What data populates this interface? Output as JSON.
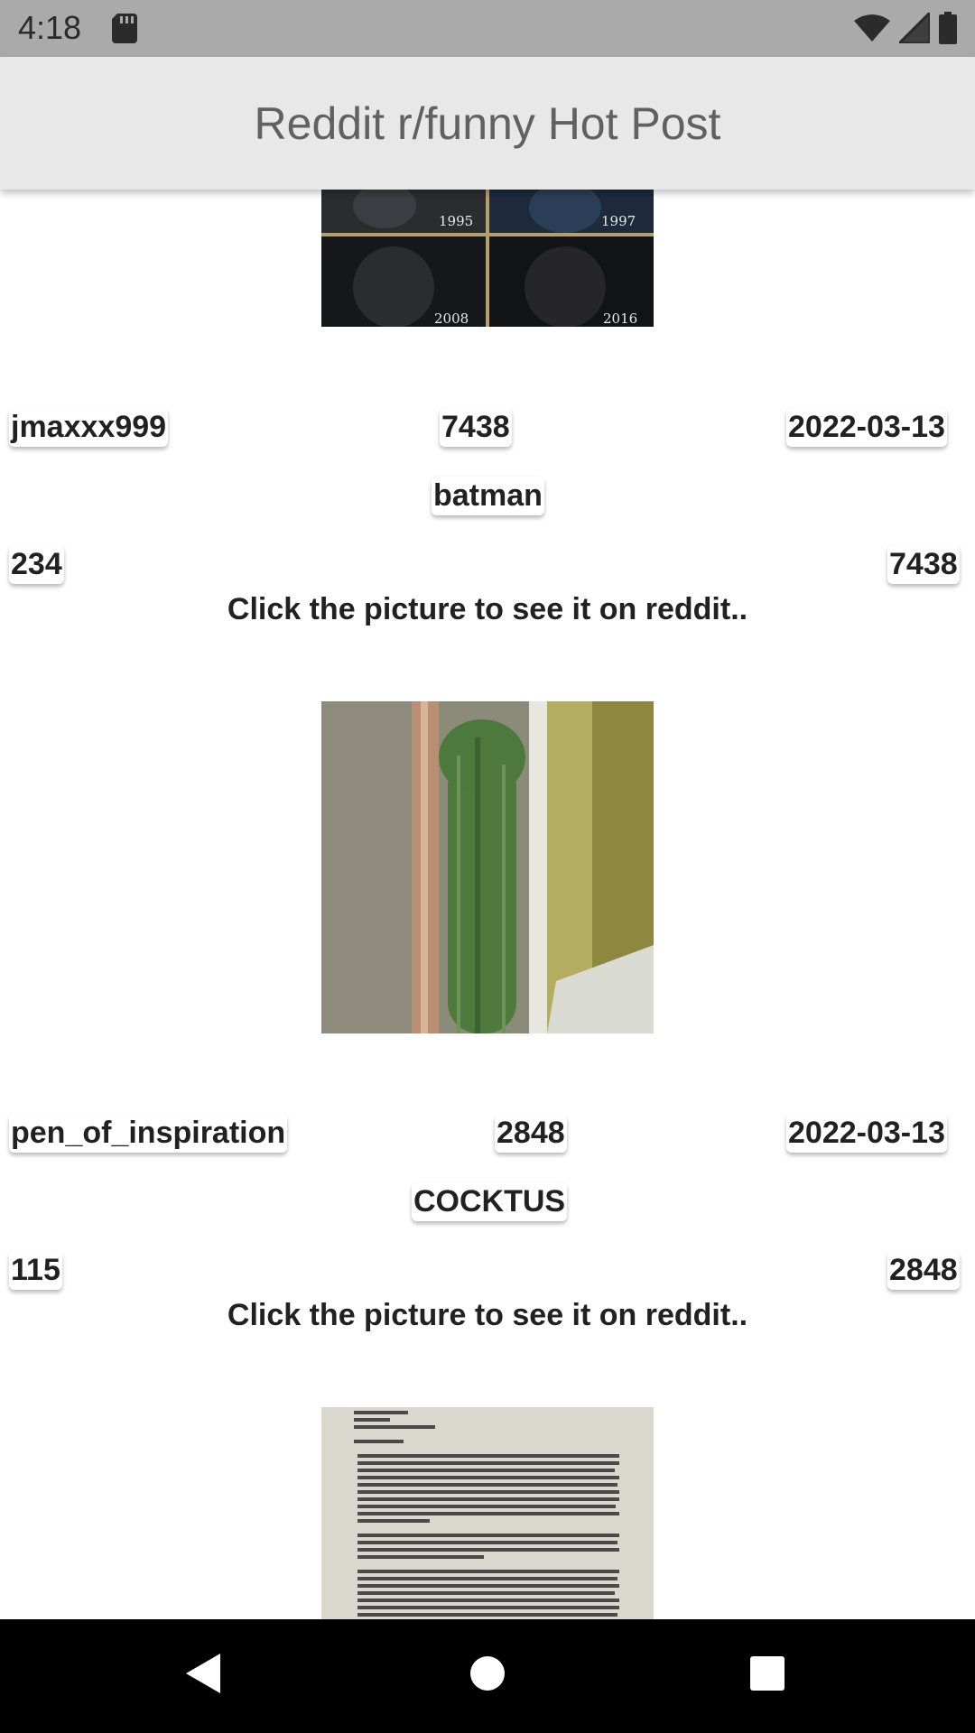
{
  "status_bar": {
    "time": "4:18",
    "icons": [
      "sd-card-icon",
      "wifi-icon",
      "signal-icon",
      "battery-icon"
    ]
  },
  "app_bar": {
    "title": "Reddit r/funny Hot Post"
  },
  "posts": [
    {
      "image_alt": "batman",
      "image_years": [
        "1995",
        "1997",
        "2008",
        "2016"
      ],
      "author": "jmaxxx999",
      "score": "7438",
      "date": "2022-03-13",
      "title": "batman",
      "comments": "234",
      "upvotes": "7438",
      "caption": "Click the picture to see it on reddit.."
    },
    {
      "image_alt": "cactus",
      "author": "pen_of_inspiration",
      "score": "2848",
      "date": "2022-03-13",
      "title": "COCKTUS",
      "comments": "115",
      "upvotes": "2848",
      "caption": "Click the picture to see it on reddit.."
    },
    {
      "image_alt": "typed letter"
    }
  ],
  "nav_bar": {
    "buttons": [
      "back-icon",
      "home-icon",
      "recents-icon"
    ]
  },
  "colors": {
    "status_bar_bg": "#aaaaaa",
    "app_bar_bg": "#e8e8e8",
    "title_text": "#616161",
    "nav_bar_bg": "#000000"
  }
}
